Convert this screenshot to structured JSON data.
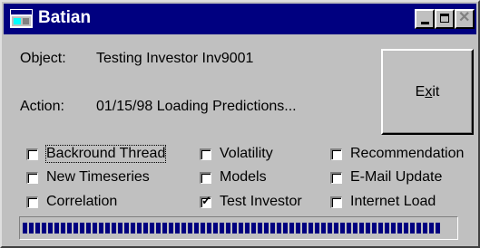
{
  "window": {
    "title": "Batian",
    "icon": "app-window-icon",
    "controls": {
      "minimize": "minimize-icon",
      "maximize": "maximize-icon",
      "close": "close-icon"
    }
  },
  "status": {
    "object_label": "Object:",
    "object_value": "Testing Investor Inv9001",
    "action_label": "Action:",
    "action_value": "01/15/98 Loading Predictions..."
  },
  "exit_button": {
    "pre": "E",
    "mnemonic": "x",
    "post": "it"
  },
  "checkboxes": [
    {
      "label": "Backround Thread",
      "checked": false,
      "focused": true
    },
    {
      "label": "New Timeseries",
      "checked": false
    },
    {
      "label": "Correlation",
      "checked": false
    },
    {
      "label": "Volatility",
      "checked": false
    },
    {
      "label": "Models",
      "checked": false
    },
    {
      "label": "Test Investor",
      "checked": true
    },
    {
      "label": "Recommendation",
      "checked": false
    },
    {
      "label": "E-Mail Update",
      "checked": false
    },
    {
      "label": "Internet Load",
      "checked": false
    }
  ],
  "progress": {
    "fraction": 0.97
  },
  "colors": {
    "titlebar": "#000080",
    "face": "#c0c0c0",
    "progress": "#000080"
  }
}
